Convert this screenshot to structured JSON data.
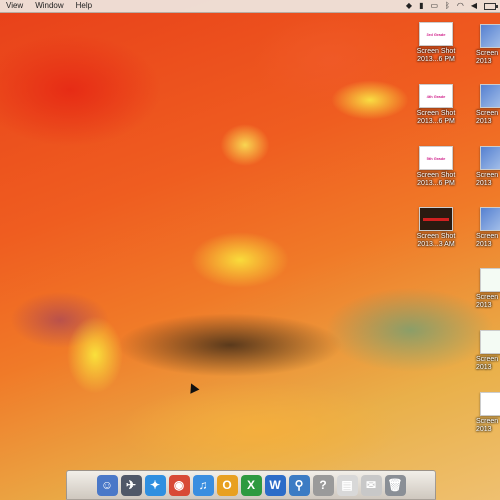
{
  "menubar": {
    "menus": [
      "View",
      "Window",
      "Help"
    ]
  },
  "status": {
    "icons": [
      "dropbox-icon",
      "document-icon",
      "airplay-icon",
      "bluetooth-icon",
      "wifi-icon",
      "volume-icon",
      "battery-icon"
    ]
  },
  "desktop": {
    "icons_col1": [
      {
        "thumb_text": "3rd Grade",
        "label_line1": "Screen Shot",
        "label_line2": "2013...6 PM"
      },
      {
        "thumb_text": "4th Grade",
        "label_line1": "Screen Shot",
        "label_line2": "2013...6 PM"
      },
      {
        "thumb_text": "5th Grade",
        "label_line1": "Screen Shot",
        "label_line2": "2013...6 PM"
      },
      {
        "thumb_text": "",
        "label_line1": "Screen Shot",
        "label_line2": "2013...3 AM"
      }
    ],
    "icons_col2": [
      {
        "label_line1": "Screen",
        "label_line2": "2013"
      },
      {
        "label_line1": "Screen",
        "label_line2": "2013"
      },
      {
        "label_line1": "Screen",
        "label_line2": "2013"
      },
      {
        "label_line1": "Screen",
        "label_line2": "2013"
      },
      {
        "label_line1": "Screen",
        "label_line2": "2013"
      },
      {
        "label_line1": "Screen",
        "label_line2": "2013"
      },
      {
        "label_line1": "Screen",
        "label_line2": "2013"
      }
    ]
  },
  "dock": {
    "items": [
      {
        "name": "finder-icon",
        "glyph": "☺",
        "color": "#4a78c8"
      },
      {
        "name": "launchpad-icon",
        "glyph": "✈",
        "color": "#505868"
      },
      {
        "name": "safari-icon",
        "glyph": "✦",
        "color": "#2f8fe0"
      },
      {
        "name": "chrome-icon",
        "glyph": "◉",
        "color": "#d84a36"
      },
      {
        "name": "itunes-icon",
        "glyph": "♫",
        "color": "#3a8ee0"
      },
      {
        "name": "outlook-icon",
        "glyph": "O",
        "color": "#e8a020"
      },
      {
        "name": "excel-icon",
        "glyph": "X",
        "color": "#2e9a40"
      },
      {
        "name": "word-icon",
        "glyph": "W",
        "color": "#2c6cc8"
      },
      {
        "name": "preview-icon",
        "glyph": "⚲",
        "color": "#3c7cc4"
      },
      {
        "name": "help-icon",
        "glyph": "?",
        "color": "#9a9a9a"
      },
      {
        "name": "document-icon",
        "glyph": "▤",
        "color": "#d8d8d8"
      },
      {
        "name": "mail-icon",
        "glyph": "✉",
        "color": "#c8c8c8"
      },
      {
        "name": "trash-icon",
        "glyph": "🗑",
        "color": "#8a8f96"
      }
    ]
  }
}
